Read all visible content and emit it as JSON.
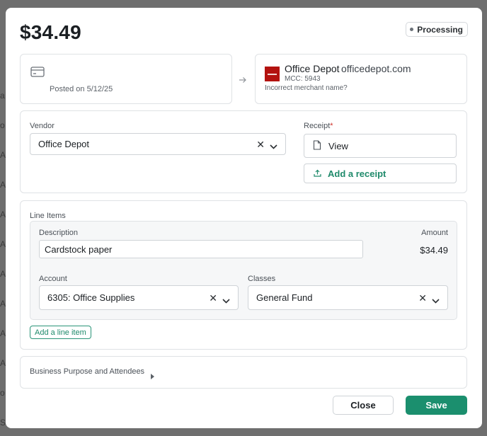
{
  "transaction": {
    "amount": "$34.49",
    "status": "Processing",
    "posted": "Posted on 5/12/25"
  },
  "merchant": {
    "name": "Office Depot",
    "domain": "officedepot.com",
    "mcc": "MCC: 5943",
    "incorrect_link": "Incorrect merchant name?"
  },
  "vendor": {
    "label": "Vendor",
    "value": "Office Depot"
  },
  "receipt": {
    "label": "Receipt",
    "required_mark": "*",
    "view_label": "View",
    "add_label": "Add a receipt"
  },
  "line_items": {
    "title": "Line Items",
    "description_label": "Description",
    "amount_label": "Amount",
    "items": [
      {
        "description": "Cardstock paper",
        "amount": "$34.49",
        "account_label": "Account",
        "account": "6305: Office Supplies",
        "classes_label": "Classes",
        "class": "General Fund"
      }
    ],
    "add_label": "Add a line item"
  },
  "purpose": {
    "label": "Business Purpose and Attendees"
  },
  "footer": {
    "close_label": "Close",
    "save_label": "Save"
  },
  "colors": {
    "accent": "#1b8f6e",
    "merchant_logo": "#b3120f",
    "required": "#d0342c"
  }
}
